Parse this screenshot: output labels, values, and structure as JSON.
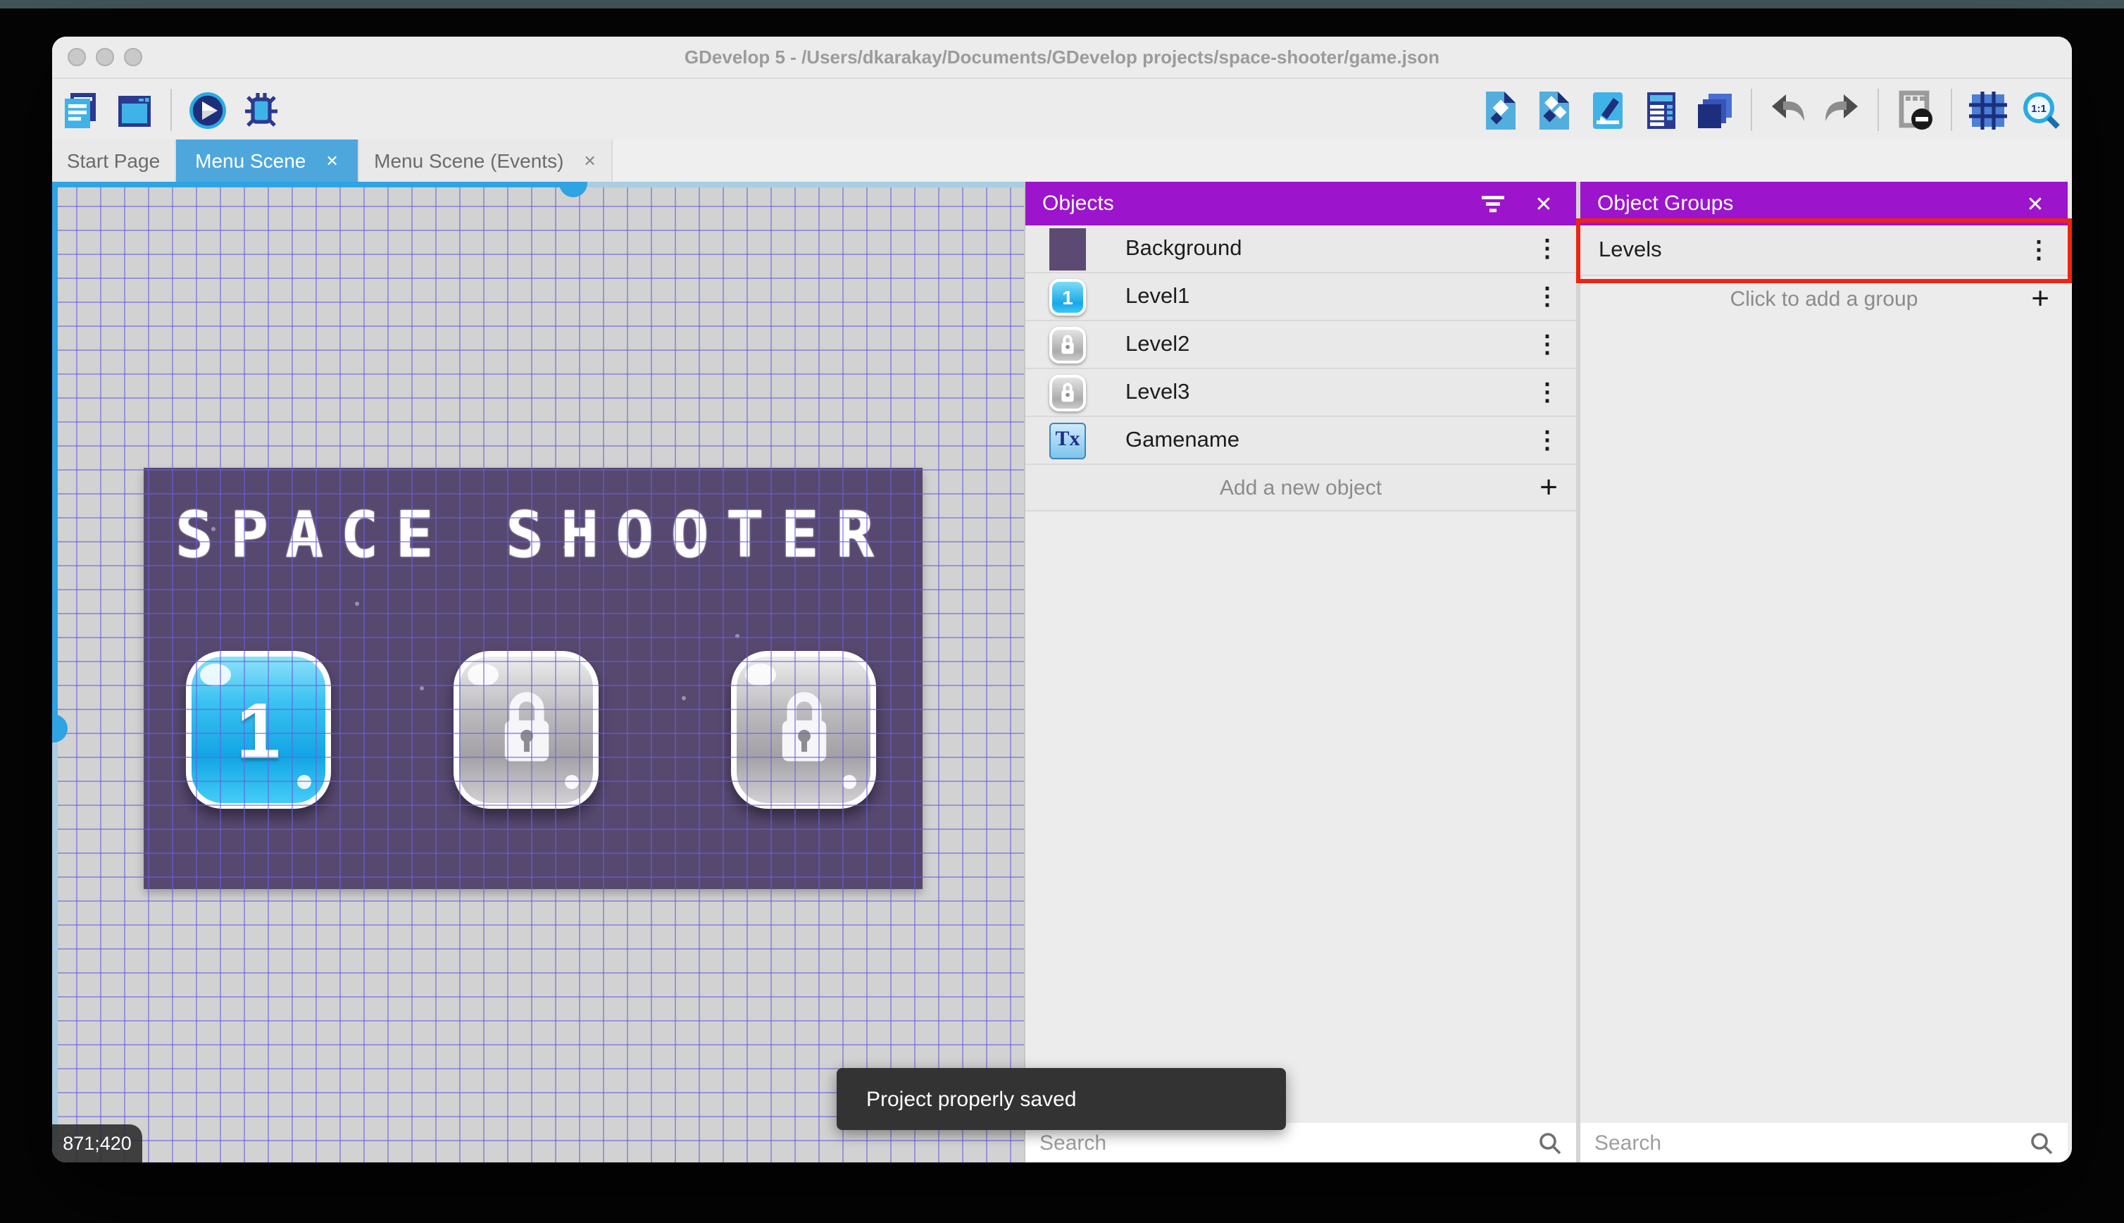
{
  "window": {
    "title": "GDevelop 5 - /Users/dkarakay/Documents/GDevelop projects/space-shooter/game.json"
  },
  "tabs": [
    {
      "label": "Start Page",
      "active": false,
      "closable": false
    },
    {
      "label": "Menu Scene",
      "active": true,
      "closable": true
    },
    {
      "label": "Menu Scene (Events)",
      "active": false,
      "closable": true
    }
  ],
  "toolbar": {
    "left_icons": [
      "project-manager-icon",
      "open-window-icon",
      "play-preview-icon",
      "debug-icon"
    ],
    "right_icons": [
      "objects-editor-icon",
      "object-groups-editor-icon",
      "scene-properties-icon",
      "instances-list-icon",
      "layers-editor-icon",
      "undo-icon",
      "redo-icon",
      "window-mask-icon",
      "grid-icon",
      "zoom-1-1-icon"
    ],
    "zoom_icon_label": "1:1"
  },
  "canvas": {
    "coordinates": "871;420",
    "scene_title": "SPACE SHOOTER",
    "level_buttons": [
      {
        "glyph": "1",
        "state": "unlocked"
      },
      {
        "state": "locked"
      },
      {
        "state": "locked"
      }
    ]
  },
  "objects_panel": {
    "title": "Objects",
    "items": [
      {
        "name": "Background",
        "icon": "background-swatch"
      },
      {
        "name": "Level1",
        "icon": "level-button-unlocked",
        "glyph": "1"
      },
      {
        "name": "Level2",
        "icon": "level-button-locked"
      },
      {
        "name": "Level3",
        "icon": "level-button-locked"
      },
      {
        "name": "Gamename",
        "icon": "text-object",
        "glyph": "Tx"
      }
    ],
    "add_label": "Add a new object",
    "search_placeholder": "Search"
  },
  "groups_panel": {
    "title": "Object Groups",
    "items": [
      {
        "name": "Levels"
      }
    ],
    "add_label": "Click to add a group",
    "search_placeholder": "Search"
  },
  "toast": {
    "message": "Project properly saved"
  },
  "icons": {
    "kebab": "⋮",
    "close": "✕",
    "plus": "+"
  },
  "colors": {
    "panel_header": "#9c14cc",
    "active_tab": "#4da7dd",
    "annotation": "#ee2413",
    "scene_background": "#57486f",
    "grid_line": "#6c63de"
  }
}
